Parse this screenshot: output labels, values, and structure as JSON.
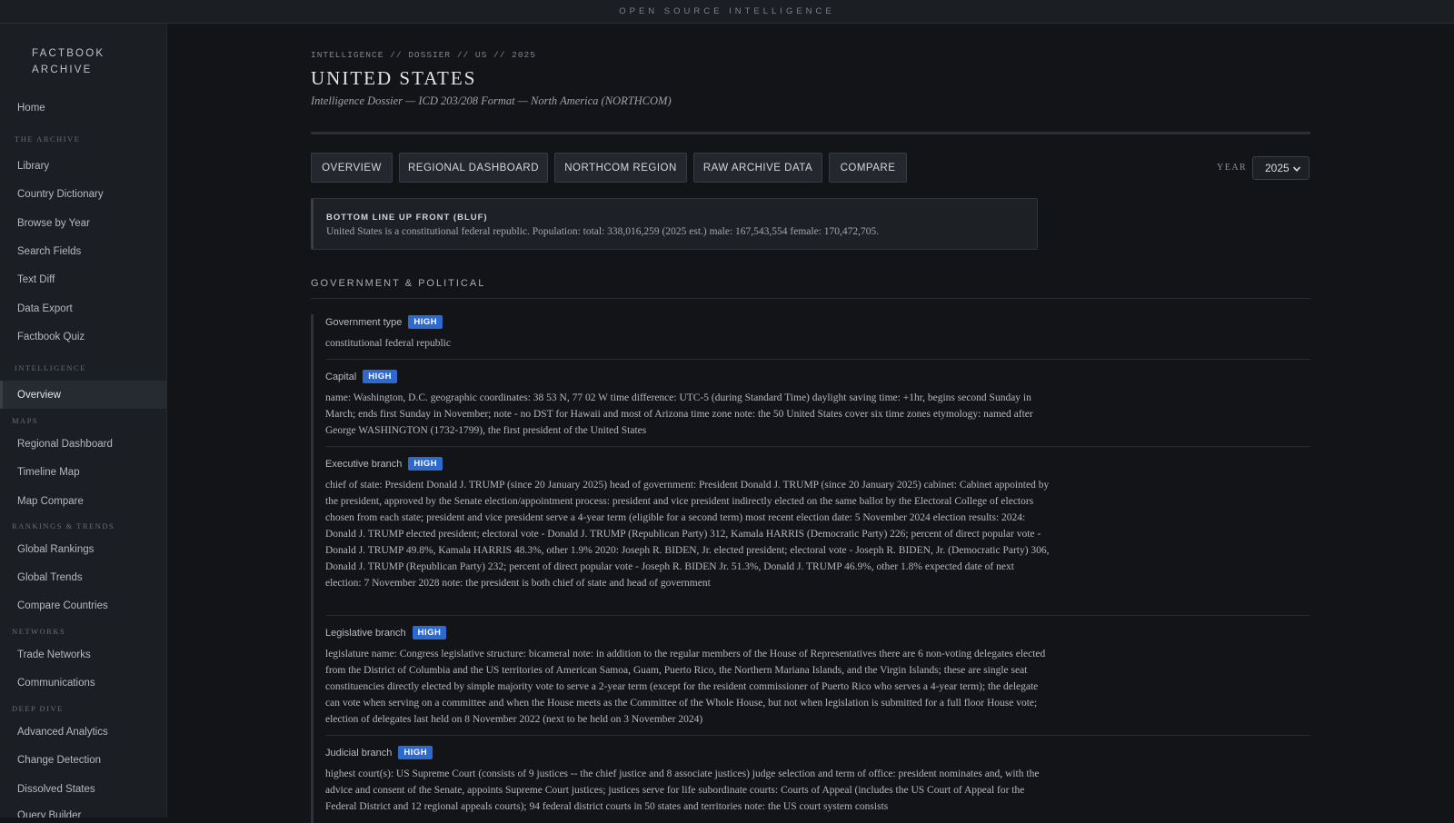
{
  "topbar": {
    "title": "OPEN SOURCE INTELLIGENCE"
  },
  "sidebar": {
    "brand_line1": "FACTBOOK",
    "brand_line2": "ARCHIVE",
    "home": "Home",
    "section_archive": "THE ARCHIVE",
    "archive_items": [
      "Library",
      "Country Dictionary",
      "Browse by Year",
      "Search Fields",
      "Text Diff",
      "Data Export",
      "Factbook Quiz"
    ],
    "section_intelligence": "INTELLIGENCE",
    "intelligence_items": [
      "Overview"
    ],
    "section_maps": "MAPS",
    "maps_items": [
      "Regional Dashboard",
      "Timeline Map",
      "Map Compare"
    ],
    "section_rankings": "RANKINGS & TRENDS",
    "rankings_items": [
      "Global Rankings",
      "Global Trends",
      "Compare Countries"
    ],
    "section_networks": "NETWORKS",
    "networks_items": [
      "Trade Networks",
      "Communications"
    ],
    "section_deepdive": "DEEP DIVE",
    "deepdive_items": [
      "Advanced Analytics",
      "Change Detection",
      "Dissolved States",
      "Query Builder"
    ]
  },
  "main": {
    "breadcrumb": "INTELLIGENCE // DOSSIER // US // 2025",
    "title": "UNITED STATES",
    "subtitle": "Intelligence Dossier — ICD 203/208 Format — North America (NORTHCOM)",
    "tabs": [
      "OVERVIEW",
      "REGIONAL DASHBOARD",
      "NORTHCOM REGION",
      "RAW ARCHIVE DATA",
      "COMPARE"
    ],
    "year_label": "YEAR",
    "year_value": "2025",
    "bluf_title": "BOTTOM LINE UP FRONT (BLUF)",
    "bluf_text": "United States is a constitutional federal republic. Population: total: 338,016,259 (2025 est.) male: 167,543,554 female: 170,472,705.",
    "section_title": "GOVERNMENT & POLITICAL",
    "fields": [
      {
        "name": "Government type",
        "badge": "HIGH",
        "value": "constitutional federal republic"
      },
      {
        "name": "Capital",
        "badge": "HIGH",
        "value": "name: Washington, D.C. geographic coordinates: 38 53 N, 77 02 W time difference: UTC-5 (during Standard Time) daylight saving time: +1hr, begins second Sunday in March; ends first Sunday in November; note - no DST for Hawaii and most of Arizona time zone note: the 50 United States cover six time zones etymology: named after George WASHINGTON (1732-1799), the first president of the United States"
      },
      {
        "name": "Executive branch",
        "badge": "HIGH",
        "value": "chief of state: President Donald J. TRUMP (since 20 January 2025) head of government: President Donald J. TRUMP (since 20 January 2025) cabinet: Cabinet appointed by the president, approved by the Senate election/appointment process: president and vice president indirectly elected on the same ballot by the Electoral College of electors chosen from each state; president and vice president serve a 4-year term (eligible for a second term) most recent election date: 5 November 2024 election results: 2024: Donald J. TRUMP elected president; electoral vote - Donald J. TRUMP (Republican Party) 312, Kamala HARRIS (Democratic Party) 226; percent of direct popular vote - Donald J. TRUMP 49.8%, Kamala HARRIS 48.3%, other 1.9% 2020: Joseph R. BIDEN, Jr. elected president; electoral vote - Joseph R. BIDEN, Jr. (Democratic Party) 306, Donald J. TRUMP (Republican Party) 232; percent of direct popular vote - Joseph R. BIDEN Jr. 51.3%, Donald J. TRUMP 46.9%, other 1.8% expected date of next election: 7 November 2028 note: the president is both chief of state and head of government"
      },
      {
        "name": "Legislative branch",
        "badge": "HIGH",
        "value": "legislature name: Congress legislative structure: bicameral note: in addition to the regular members of the House of Representatives there are 6 non-voting delegates elected from the District of Columbia and the US territories of American Samoa, Guam, Puerto Rico, the Northern Mariana Islands, and the Virgin Islands; these are single seat constituencies directly elected by simple majority vote to serve a 2-year term (except for the resident commissioner of Puerto Rico who serves a 4-year term); the delegate can vote when serving on a committee and when the House meets as the Committee of the Whole House, but not when legislation is submitted for a full floor House vote; election of delegates last held on 8 November 2022 (next to be held on 3 November 2024)"
      },
      {
        "name": "Judicial branch",
        "badge": "HIGH",
        "value": "highest court(s): US Supreme Court (consists of 9 justices -- the chief justice and 8 associate justices) judge selection and term of office: president nominates and, with the advice and consent of the Senate, appoints Supreme Court justices; justices serve for life subordinate courts: Courts of Appeal (includes the US Court of Appeal for the Federal District and 12 regional appeals courts); 94 federal district courts in 50 states and territories note: the US court system consists"
      }
    ]
  }
}
